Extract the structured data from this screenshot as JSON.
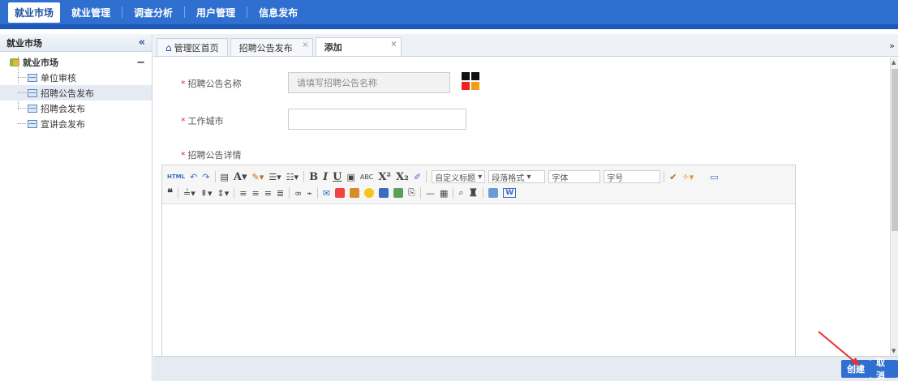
{
  "topnav": {
    "items": [
      "就业市场",
      "就业管理",
      "调查分析",
      "用户管理",
      "信息发布"
    ]
  },
  "left": {
    "title": "就业市场",
    "collapse_icon": "«",
    "tree": {
      "root": "就业市场",
      "collapse": "−",
      "items": [
        "单位审核",
        "招聘公告发布",
        "招聘会发布",
        "宣讲会发布"
      ]
    }
  },
  "tabs": [
    {
      "label": "管理区首页",
      "icon": "home-icon"
    },
    {
      "label": "招聘公告发布",
      "close": "×"
    },
    {
      "label": "添加",
      "close": "×"
    }
  ],
  "tabs_more": "»",
  "form": {
    "name_label": "招聘公告名称",
    "name_placeholder": "请填写招聘公告名称",
    "city_label": "工作城市",
    "city_value": "",
    "detail_label": "招聘公告详情",
    "required_mark": "*"
  },
  "editor": {
    "html_label": "HTML",
    "format_b": "B",
    "format_i": "I",
    "format_u": "U",
    "custom_title": "自定义标题",
    "paragraph": "段落格式",
    "font": "字体",
    "font_size": "字号"
  },
  "buttons": {
    "create": "创建",
    "cancel": "取消"
  },
  "colors": {
    "accent": "#2f6fcf",
    "required": "#e24",
    "annotation": "#e8322b"
  }
}
